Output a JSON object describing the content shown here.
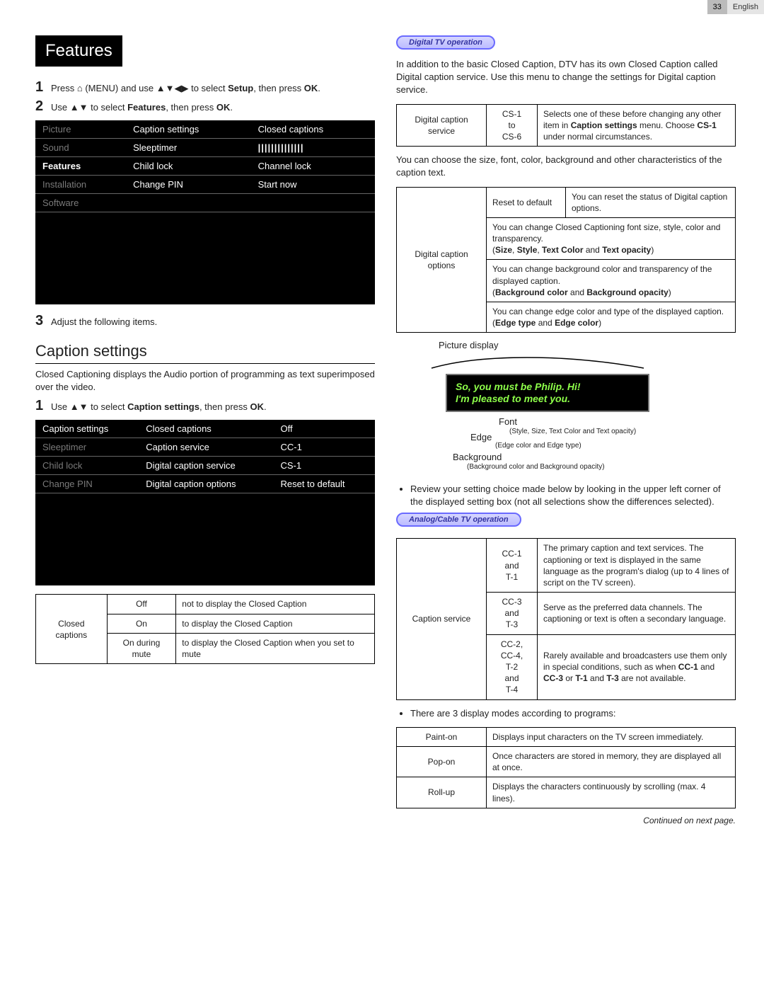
{
  "header": {
    "page_number": "33",
    "language": "English"
  },
  "left_col": {
    "section_title": "Features",
    "step1": "Press ⌂ (MENU) and use ▲▼◀▶ to select Setup, then press OK.",
    "step2": "Use ▲▼ to select Features, then press OK.",
    "osd1": {
      "rows": [
        {
          "c1": "Picture",
          "c1_dim": true,
          "c2": "Caption settings",
          "c3": "Closed captions"
        },
        {
          "c1": "Sound",
          "c1_dim": true,
          "c2": "Sleeptimer",
          "c3": "||||||||||||||",
          "c3_bars": true
        },
        {
          "c1": "Features",
          "c1_dim": false,
          "c2": "Child lock",
          "c3": "Channel lock"
        },
        {
          "c1": "Installation",
          "c1_dim": true,
          "c2": "Change PIN",
          "c3": "Start now"
        },
        {
          "c1": "Software",
          "c1_dim": true,
          "c2": "",
          "c3": ""
        }
      ]
    },
    "step3": "Adjust the following items.",
    "caption_settings_heading": "Caption settings",
    "caption_settings_intro": "Closed Captioning displays the Audio portion of programming as text superimposed over the video.",
    "step_cs_1": "Use ▲▼ to select Caption settings, then press OK.",
    "osd2": {
      "rows": [
        {
          "c1": "Caption settings",
          "c1_dim": false,
          "c2": "Closed captions",
          "c3": "Off"
        },
        {
          "c1": "Sleeptimer",
          "c1_dim": true,
          "c2": "Caption service",
          "c3": "CC-1"
        },
        {
          "c1": "Child lock",
          "c1_dim": true,
          "c2": "Digital caption service",
          "c3": "CS-1"
        },
        {
          "c1": "Change PIN",
          "c1_dim": true,
          "c2": "Digital caption options",
          "c3": "Reset to default"
        }
      ]
    },
    "info_table_left": {
      "row_label": "Closed captions",
      "rows": [
        {
          "setting": "Off",
          "desc": "not to display the Closed Caption"
        },
        {
          "setting": "On",
          "desc": "to display the Closed Caption"
        },
        {
          "setting": "On during mute",
          "desc": "to display the Closed Caption when you set to mute"
        }
      ]
    }
  },
  "right_col": {
    "digital_pill": "Digital TV operation",
    "digital_intro": "In addition to the basic Closed Caption, DTV has its own Closed Caption called Digital caption service. Use this menu to change the settings for Digital caption service.",
    "dcs_table": {
      "label": "Digital caption service",
      "val": "CS-1\nto\nCS-6",
      "desc": "Selects one of these before changing any other item in Caption settings menu. Choose CS-1 under normal circumstances."
    },
    "characteristics_text": "You can choose the size, font, color, background and other characteristics of the caption text.",
    "dco_table": {
      "label": "Digital caption options",
      "rows": [
        {
          "title": "Reset to default",
          "desc": "You can reset the status of Digital caption options."
        },
        {
          "desc": "You can change Closed Captioning font size, style, color and transparency.",
          "sub": "(Size, Style, Text Color and Text opacity)"
        },
        {
          "desc": "You can change background color and transparency of the displayed caption.",
          "sub": "(Background color and Background opacity)"
        },
        {
          "desc": "You can change edge color and type of the displayed caption.",
          "sub": "(Edge type and Edge color)"
        }
      ]
    },
    "picture_display_label": "Picture display",
    "caption_line1": "So, you must be Philip. Hi!",
    "caption_line2": "I'm pleased to meet you.",
    "font_label": "Font",
    "font_sub": "(Style, Size, Text Color and Text opacity)",
    "edge_label": "Edge",
    "edge_sub": "(Edge color and Edge type)",
    "background_label": "Background",
    "background_sub": "(Background color and Background opacity)",
    "review_bullet": "Review your setting choice made below by looking in the upper left corner of the displayed setting box (not all selections show the differences selected).",
    "analog_pill": "Analog/Cable TV operation",
    "caption_service_table": {
      "label": "Caption service",
      "rows": [
        {
          "val": "CC-1\nand\nT-1",
          "desc": "The primary caption and text services. The captioning or text is displayed in the same language as the program's dialog (up to 4 lines of script on the TV screen)."
        },
        {
          "val": "CC-3\nand\nT-3",
          "desc": "Serve as the preferred data channels. The captioning or text is often a secondary language."
        },
        {
          "val": "CC-2,\nCC-4,\nT-2\nand\nT-4",
          "desc": "Rarely available and broadcasters use them only in special conditions, such as when CC-1 and CC-3 or T-1 and T-3 are not available."
        }
      ]
    },
    "display_modes_bullet": "There are 3 display modes according to programs:",
    "display_modes_table": [
      {
        "name": "Paint-on",
        "desc": "Displays input characters on the TV screen immediately."
      },
      {
        "name": "Pop-on",
        "desc": "Once characters are stored in memory, they are displayed all at once."
      },
      {
        "name": "Roll-up",
        "desc": "Displays the characters continuously by scrolling (max. 4 lines)."
      }
    ],
    "continued": "Continued on next page."
  }
}
